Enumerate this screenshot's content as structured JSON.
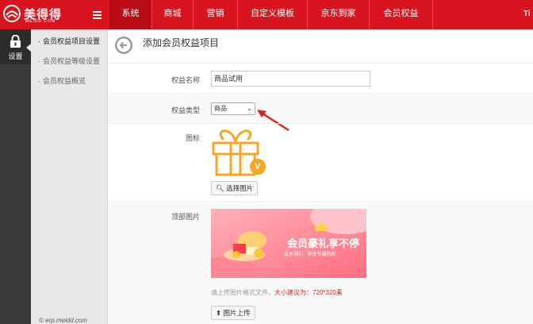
{
  "brand": {
    "name": "美得得",
    "sub": "MEIDD.COM",
    "color": "#d8141e"
  },
  "top_nav": [
    {
      "label": "系统",
      "active": true
    },
    {
      "label": "商城",
      "active": false
    },
    {
      "label": "营销",
      "active": false
    },
    {
      "label": "自定义模板",
      "active": false
    },
    {
      "label": "京东到家",
      "active": false
    },
    {
      "label": "会员权益",
      "active": false
    }
  ],
  "top_right_text": "Ti",
  "rail": {
    "settings_label": "设置"
  },
  "submenu": {
    "items": [
      {
        "label": "会员权益项目设置",
        "active": true
      },
      {
        "label": "会员权益等级设置",
        "active": false
      },
      {
        "label": "会员权益概览",
        "active": false
      }
    ],
    "copyright": "© erp.meidd.com"
  },
  "page": {
    "title": "添加会员权益项目",
    "fields": {
      "name": {
        "label": "权益名称",
        "value": "商品试用"
      },
      "type": {
        "label": "权益类型",
        "value": "商品"
      },
      "icon": {
        "label": "图标",
        "button": "选择图片",
        "badge": "V"
      },
      "top_image": {
        "label": "顶部图片",
        "banner_title": "会员豪礼享不停",
        "banner_sub": "会员福利 · 尊享专属特权",
        "hint_prefix": "请上传图片格式文件，",
        "hint_warn": "大小建议为：720*320素",
        "upload_button": "图片上传"
      }
    }
  },
  "colors": {
    "accent": "#d8141e",
    "icon_orange": "#f5a623",
    "annotation": "#e02020"
  }
}
